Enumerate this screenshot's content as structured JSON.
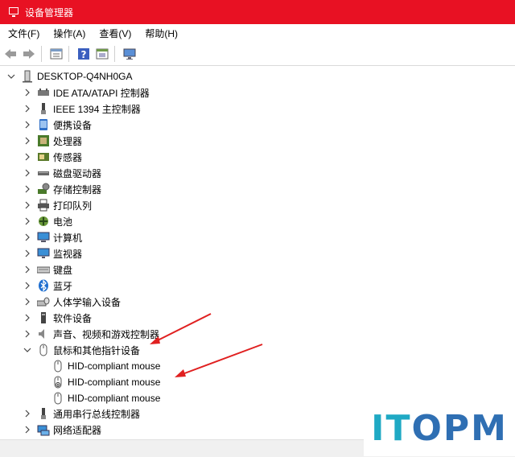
{
  "window": {
    "title": "设备管理器"
  },
  "menu": [
    {
      "label": "文件(F)"
    },
    {
      "label": "操作(A)"
    },
    {
      "label": "查看(V)"
    },
    {
      "label": "帮助(H)"
    }
  ],
  "toolbar": {
    "buttons": [
      "back-arrow-icon",
      "forward-arrow-icon",
      "properties-icon",
      "help-icon",
      "view-icon",
      "monitor-icon"
    ]
  },
  "tree": {
    "root": {
      "label": "DESKTOP-Q4NH0GA",
      "expanded": true
    },
    "categories": [
      {
        "label": "IDE ATA/ATAPI 控制器",
        "icon": "ide-controller-icon"
      },
      {
        "label": "IEEE 1394 主控制器",
        "icon": "ieee1394-icon"
      },
      {
        "label": "便携设备",
        "icon": "portable-device-icon"
      },
      {
        "label": "处理器",
        "icon": "processor-icon"
      },
      {
        "label": "传感器",
        "icon": "sensor-icon"
      },
      {
        "label": "磁盘驱动器",
        "icon": "disk-drive-icon"
      },
      {
        "label": "存储控制器",
        "icon": "storage-controller-icon"
      },
      {
        "label": "打印队列",
        "icon": "printer-icon"
      },
      {
        "label": "电池",
        "icon": "battery-icon"
      },
      {
        "label": "计算机",
        "icon": "computer-icon"
      },
      {
        "label": "监视器",
        "icon": "monitor-icon"
      },
      {
        "label": "键盘",
        "icon": "keyboard-icon"
      },
      {
        "label": "蓝牙",
        "icon": "bluetooth-icon"
      },
      {
        "label": "人体学输入设备",
        "icon": "hid-icon"
      },
      {
        "label": "软件设备",
        "icon": "software-device-icon"
      },
      {
        "label": "声音、视频和游戏控制器",
        "icon": "audio-icon"
      },
      {
        "label": "鼠标和其他指针设备",
        "icon": "mouse-icon",
        "expanded": true,
        "children": [
          {
            "label": "HID-compliant mouse",
            "icon": "mouse-icon"
          },
          {
            "label": "HID-compliant mouse",
            "icon": "mouse-warning-icon"
          },
          {
            "label": "HID-compliant mouse",
            "icon": "mouse-icon"
          }
        ]
      },
      {
        "label": "通用串行总线控制器",
        "icon": "usb-icon"
      },
      {
        "label": "网络适配器",
        "icon": "network-adapter-icon"
      }
    ]
  },
  "watermark": {
    "part1": "IT",
    "part2": "OPM"
  },
  "colors": {
    "titlebar": "#e81123",
    "annotation_arrow": "#e02020",
    "watermark_cyan": "#1fa9c4",
    "watermark_blue": "#2f6fb3"
  }
}
